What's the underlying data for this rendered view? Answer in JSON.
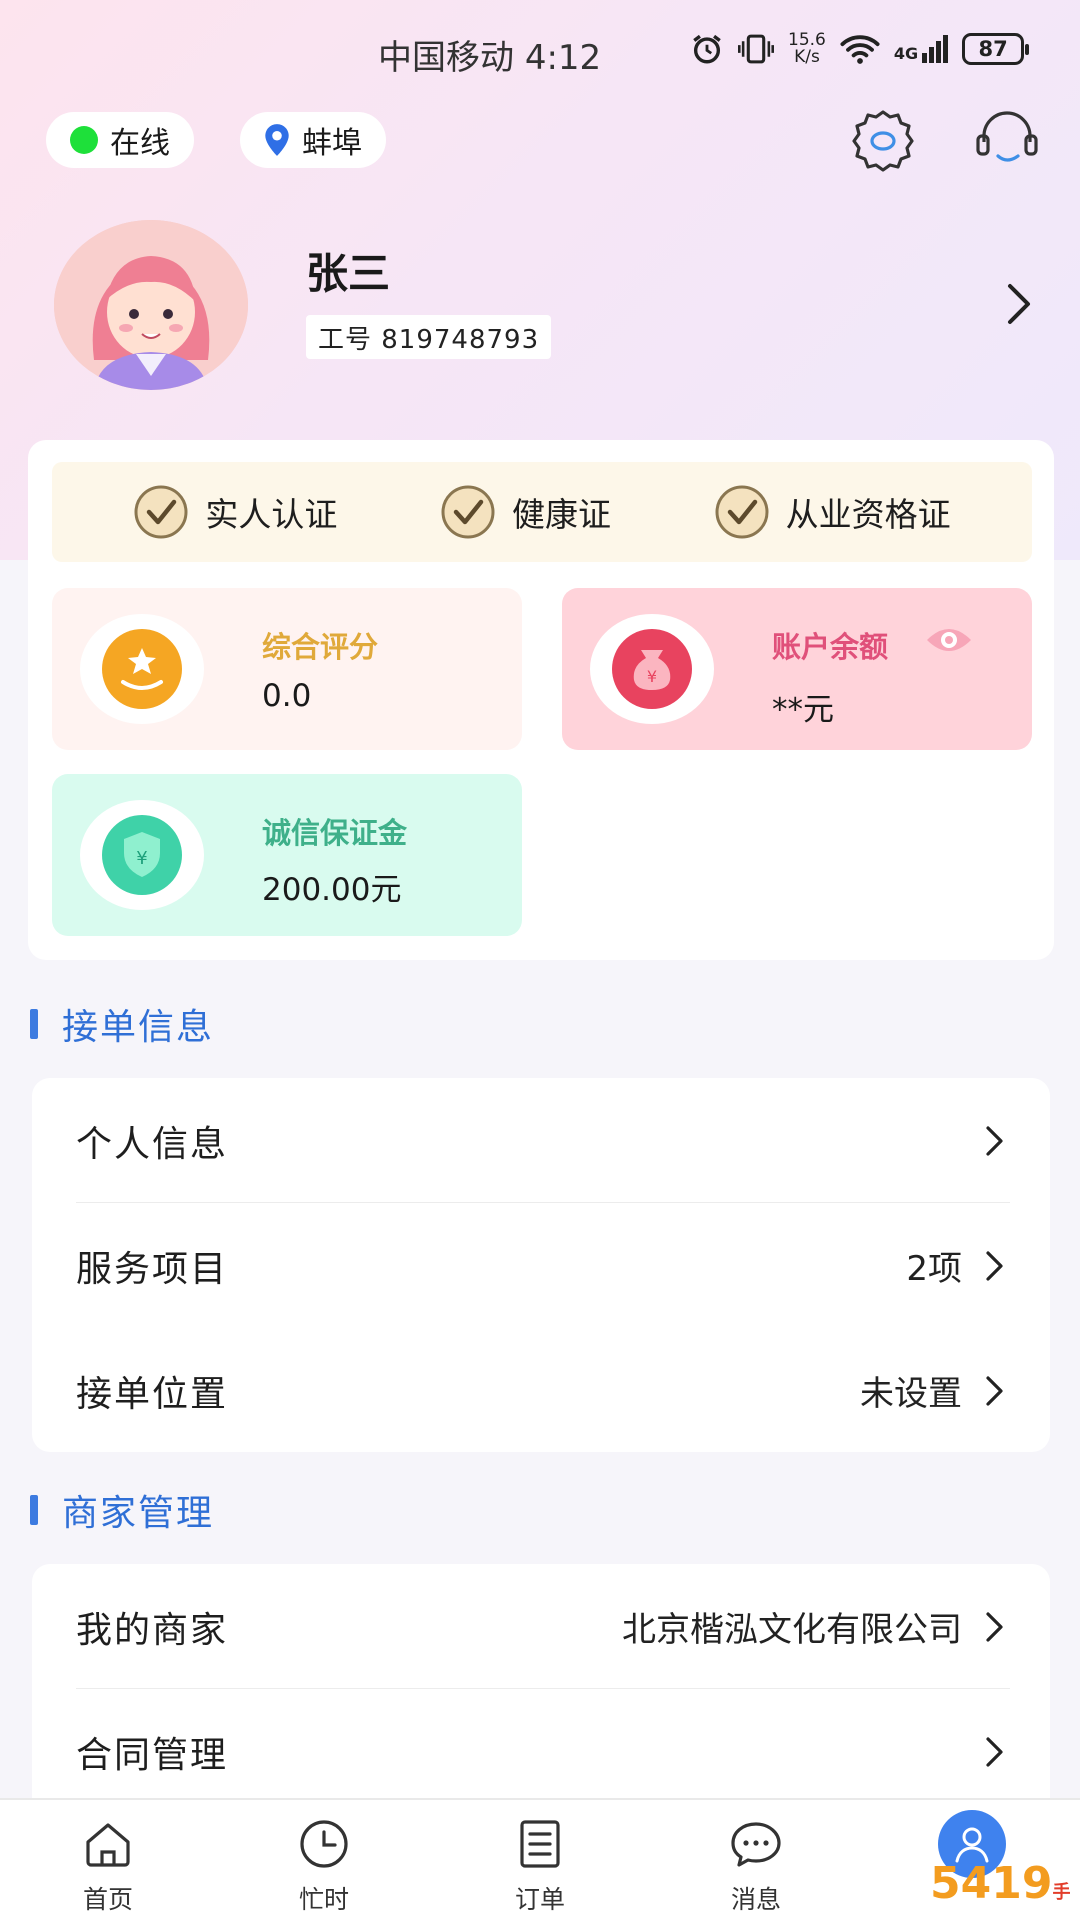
{
  "status_bar": {
    "carrier": "中国移动",
    "time": "4:12",
    "speed_value": "15.6",
    "speed_unit": "K/s",
    "network": "4G",
    "battery": "87"
  },
  "header": {
    "online_label": "在线",
    "city": "蚌埠"
  },
  "profile": {
    "name": "张三",
    "employee_no": "工号 819748793"
  },
  "certifications": [
    {
      "label": "实人认证"
    },
    {
      "label": "健康证"
    },
    {
      "label": "从业资格证"
    }
  ],
  "stats": {
    "rating": {
      "title": "综合评分",
      "value": "0.0"
    },
    "balance": {
      "title": "账户余额",
      "value": "**元"
    },
    "deposit": {
      "title": "诚信保证金",
      "value": "200.00元"
    }
  },
  "section_orders": {
    "title": "接单信息",
    "rows": [
      {
        "label": "个人信息",
        "value": ""
      },
      {
        "label": "服务项目",
        "value": "2项"
      },
      {
        "label": "接单位置",
        "value": "未设置"
      }
    ]
  },
  "section_merchant": {
    "title": "商家管理",
    "rows": [
      {
        "label": "我的商家",
        "value": "北京楷泓文化有限公司"
      },
      {
        "label": "合同管理",
        "value": ""
      }
    ]
  },
  "tabs": [
    {
      "label": "首页"
    },
    {
      "label": "忙时"
    },
    {
      "label": "订单"
    },
    {
      "label": "消息"
    },
    {
      "label": ""
    }
  ],
  "watermark": {
    "main": "5419",
    "sub": "手游网"
  },
  "colors": {
    "accent": "#3f82ee",
    "section_title": "#2f6fd6",
    "rating_title": "#e0a93a",
    "balance_title": "#e0507a",
    "deposit_title": "#3fb08a",
    "online_dot": "#1ee03a"
  }
}
